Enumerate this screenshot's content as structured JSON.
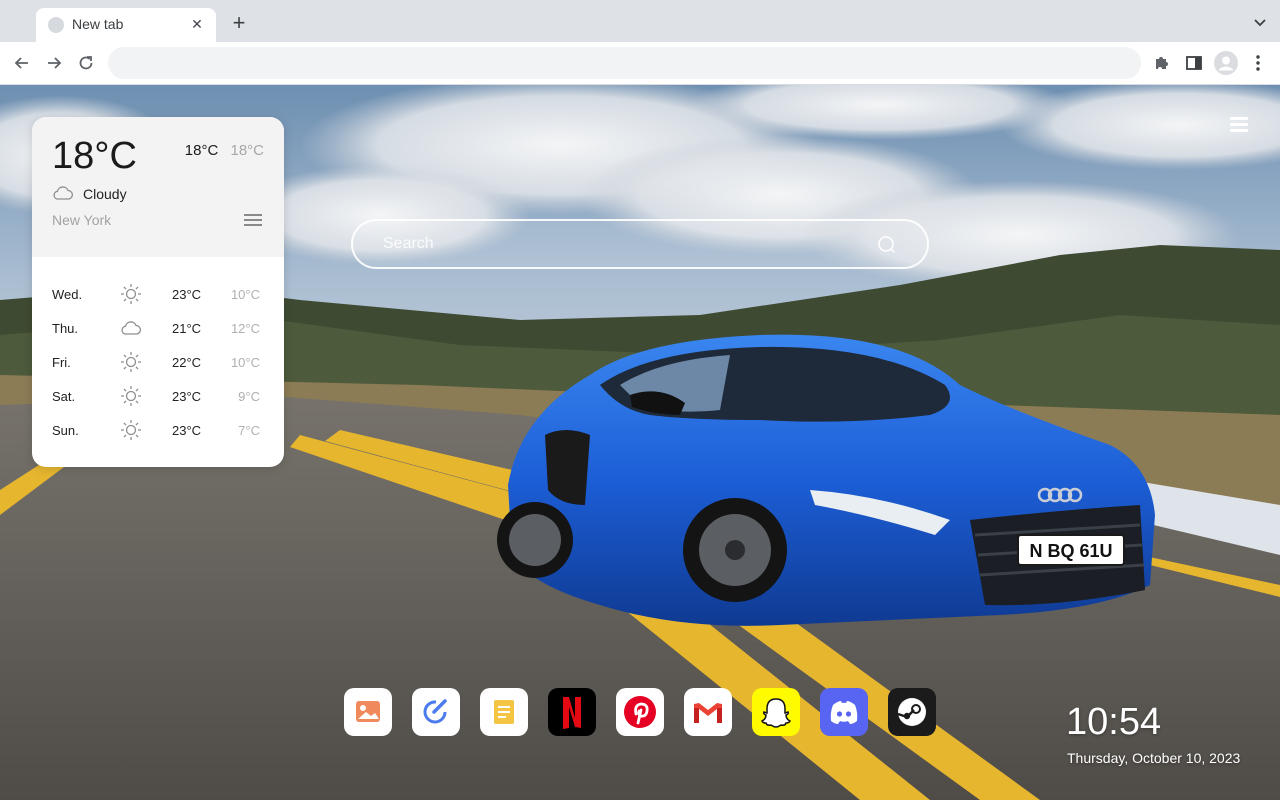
{
  "browser": {
    "tab_title": "New tab",
    "omnibox_value": ""
  },
  "weather": {
    "current_temp": "18°C",
    "high": "18°C",
    "low": "18°C",
    "condition": "Cloudy",
    "city": "New York",
    "forecast": [
      {
        "day": "Wed.",
        "icon": "sun-icon",
        "high": "23°C",
        "low": "10°C"
      },
      {
        "day": "Thu.",
        "icon": "cloud-icon",
        "high": "21°C",
        "low": "12°C"
      },
      {
        "day": "Fri.",
        "icon": "sun-icon",
        "high": "22°C",
        "low": "10°C"
      },
      {
        "day": "Sat.",
        "icon": "sun-icon",
        "high": "23°C",
        "low": "9°C"
      },
      {
        "day": "Sun.",
        "icon": "sun-icon",
        "high": "23°C",
        "low": "7°C"
      }
    ]
  },
  "search": {
    "placeholder": "Search"
  },
  "dock": {
    "apps": [
      "gallery-icon",
      "todo-icon",
      "notes-icon",
      "netflix-icon",
      "pinterest-icon",
      "gmail-icon",
      "snapchat-icon",
      "discord-icon",
      "steam-icon"
    ]
  },
  "clock": {
    "time": "10:54",
    "date": "Thursday, October 10, 2023"
  },
  "colors": {
    "netflix": "#e50914",
    "pinterest": "#e60023",
    "snapchat": "#fffc00",
    "discord": "#5865f2",
    "steam": "#1b1b1b",
    "car_blue": "#1c5ed6"
  }
}
